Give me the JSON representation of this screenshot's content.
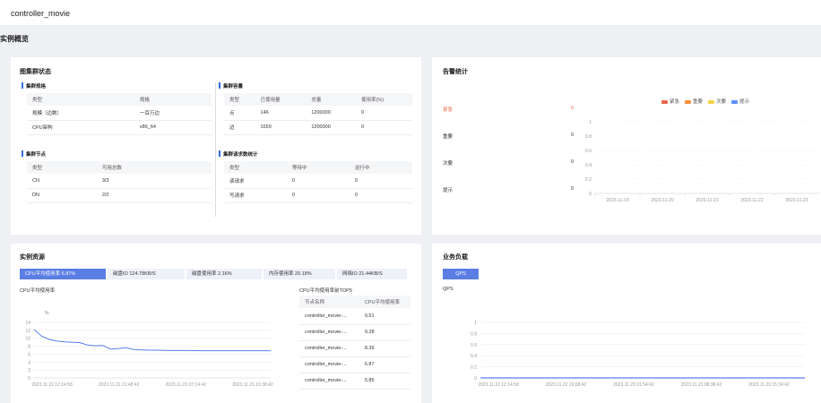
{
  "app_title": "controller_movie",
  "section_title": "实例概览",
  "cluster_status": {
    "title": "图集群状态",
    "spec": {
      "title": "集群规格",
      "headers": [
        "类型",
        "规格"
      ],
      "rows": [
        [
          "规模（边数）",
          "一百万边"
        ],
        [
          "CPU架构",
          "x86_64"
        ]
      ]
    },
    "capacity": {
      "title": "集群容量",
      "headers": [
        "类型",
        "已使用量",
        "总量",
        "使用率(%)"
      ],
      "rows": [
        [
          "点",
          "146",
          "1200000",
          "0"
        ],
        [
          "边",
          "1659",
          "1200000",
          "0"
        ]
      ]
    },
    "nodes": {
      "title": "集群节点",
      "headers": [
        "类型",
        "可用总数"
      ],
      "rows": [
        [
          "CN",
          "3/3"
        ],
        [
          "DN",
          "2/2"
        ]
      ]
    },
    "requests": {
      "title": "集群请求数统计",
      "headers": [
        "类型",
        "等待中",
        "运行中"
      ],
      "rows": [
        [
          "读请求",
          "0",
          "0"
        ],
        [
          "写请求",
          "0",
          "0"
        ]
      ]
    }
  },
  "alarms": {
    "title": "告警统计",
    "rows": [
      {
        "label": "紧急",
        "count": "0"
      },
      {
        "label": "重要",
        "count": "0"
      },
      {
        "label": "次要",
        "count": "0"
      },
      {
        "label": "提示",
        "count": "0"
      }
    ],
    "legend": [
      {
        "name": "紧急",
        "color": "#e8684a"
      },
      {
        "name": "重要",
        "color": "#f6903d"
      },
      {
        "name": "次要",
        "color": "#f6d34a"
      },
      {
        "name": "提示",
        "color": "#5b8ff9"
      }
    ],
    "urgent_color": "#e8684a"
  },
  "resources": {
    "title": "实例资源",
    "tabs": [
      {
        "label": "CPU平均使用率  6.87%"
      },
      {
        "label": "磁盘IO   124.78KB/S"
      },
      {
        "label": "磁盘使用率  2.16%"
      },
      {
        "label": "内存使用率  20.18%"
      },
      {
        "label": "网络IO  21.44KB/S"
      }
    ],
    "chart_title": "CPU平均使用率",
    "unit_label": "%",
    "top5": {
      "title": "CPU平均使用率前TOP5",
      "headers": [
        "节点名称",
        "CPU平均使用率"
      ],
      "rows": [
        [
          "controller_movie-...",
          "9.51"
        ],
        [
          "controller_movie-...",
          "9.28"
        ],
        [
          "controller_movie-...",
          "8.39"
        ],
        [
          "controller_movie-...",
          "6.87"
        ],
        [
          "controller_movie-...",
          "5.85"
        ]
      ]
    }
  },
  "business": {
    "title": "业务负载",
    "button": "QPS",
    "chart_title": "QPS"
  },
  "chart_data": [
    {
      "type": "bar",
      "x": [
        "2023-11-19",
        "2023-11-20",
        "2023-11-21",
        "2023-11-22",
        "2023-11-23"
      ],
      "series": [
        {
          "name": "紧急",
          "values": [
            0,
            0,
            0,
            0,
            0
          ]
        },
        {
          "name": "重要",
          "values": [
            0,
            0,
            0,
            0,
            0
          ]
        },
        {
          "name": "次要",
          "values": [
            0,
            0,
            0,
            0,
            0
          ]
        },
        {
          "name": "提示",
          "values": [
            0,
            0,
            0,
            0,
            0
          ]
        }
      ],
      "yticks": [
        "0",
        "0.2",
        "0.4",
        "0.6",
        "0.8",
        "1"
      ],
      "ylim": [
        0,
        1
      ]
    },
    {
      "type": "line",
      "x_ticks": [
        "2023.11.22 12:14:58",
        "2023.11.22 21:48:42",
        "2023.11.23 07:14:42",
        "2023.11.23 16:38:42"
      ],
      "yticks": [
        "0",
        "2",
        "4",
        "6",
        "8",
        "10",
        "12",
        "14"
      ],
      "ylim": [
        0,
        14
      ],
      "values": [
        12.2,
        10.5,
        9.7,
        9.3,
        9.1,
        9.0,
        8.9,
        8.3,
        8.1,
        8.2,
        7.3,
        7.4,
        7.6,
        7.2,
        7.1,
        7.0,
        7.0,
        6.95,
        6.9,
        6.9,
        6.9,
        6.88,
        6.87,
        6.87,
        6.87,
        6.87,
        6.87,
        6.87,
        6.87,
        6.87,
        6.87,
        6.87
      ],
      "color": "#5b7ee5"
    },
    {
      "type": "line",
      "x_ticks": [
        "2023.11.22 12:14:58",
        "2023.11.22 19:08:42",
        "2023.11.23 01:54:42",
        "2023.11.23 08:38:42",
        "2023.11.23 15:24:42"
      ],
      "yticks": [
        "0",
        "0.2",
        "0.4",
        "0.6",
        "0.8",
        "1"
      ],
      "ylim": [
        0,
        1
      ],
      "values": [
        0,
        0,
        0,
        0,
        0,
        0,
        0,
        0,
        0,
        0
      ],
      "color": "#5b7ee5"
    }
  ]
}
